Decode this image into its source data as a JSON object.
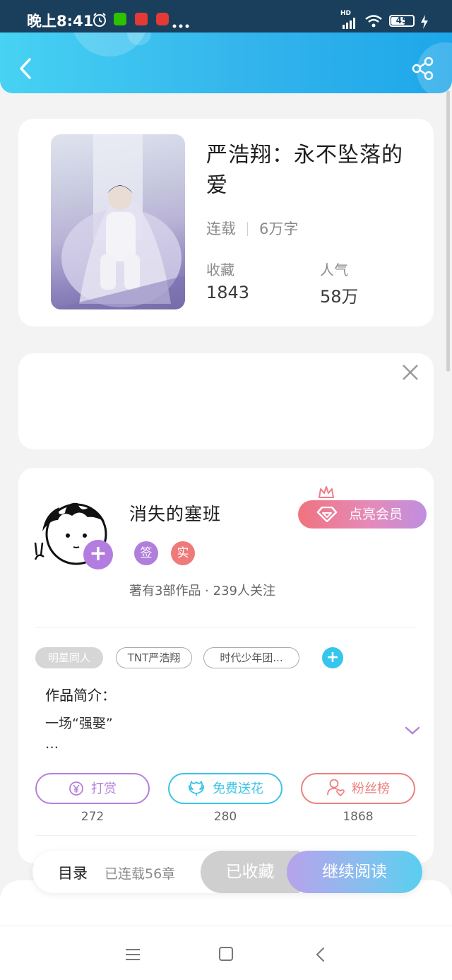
{
  "status_bar": {
    "time": "晚上8:41",
    "battery": "45",
    "network": "HD"
  },
  "header": {
    "back_icon": "chevron-left-icon",
    "share_icon": "share-icon"
  },
  "book": {
    "title": "严浩翔：永不坠落的爱",
    "status": "连载",
    "word_count": "6万字",
    "favorites_label": "收藏",
    "favorites_value": "1843",
    "popularity_label": "人气",
    "popularity_value": "58万"
  },
  "ad_card": {
    "close_icon": "close-icon"
  },
  "author": {
    "name": "消失的塞班",
    "badge_signed": "签",
    "badge_verified": "实",
    "works_info": "著有3部作品 · 239人关注",
    "vip_button": "点亮会员",
    "follow_icon": "plus-icon"
  },
  "tags": [
    "明星同人",
    "TNT严浩翔",
    "时代少年团..."
  ],
  "intro": {
    "title": "作品简介：",
    "text_line1": "一场“强娶”",
    "text_line2": "…"
  },
  "actions": [
    {
      "label": "打赏",
      "count": "272",
      "color": "#b47fdc"
    },
    {
      "label": "免费送花",
      "count": "280",
      "color": "#3bc4e4"
    },
    {
      "label": "粉丝榜",
      "count": "1868",
      "color": "#ee7f7f"
    }
  ],
  "bottom_bar": {
    "toc": "目录",
    "chapters": "已连载56章",
    "collected": "已收藏",
    "continue": "继续阅读"
  },
  "colors": {
    "header": "#33b4ec",
    "accent_purple": "#b37de0",
    "accent_cyan": "#35c6ee"
  }
}
